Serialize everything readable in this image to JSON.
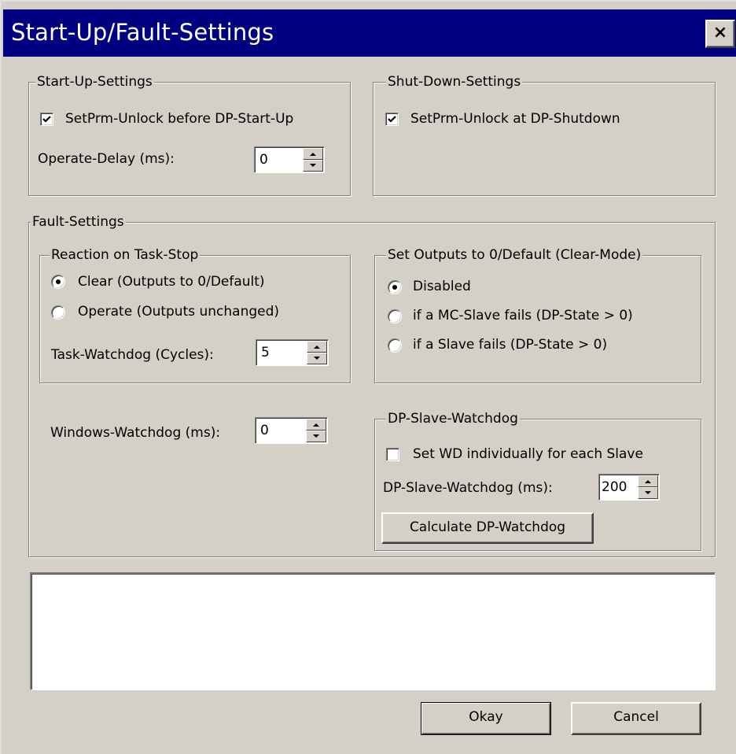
{
  "window": {
    "title": "Start-Up/Fault-Settings",
    "close_label": "×"
  },
  "startup": {
    "legend": "Start-Up-Settings",
    "setprm_unlock": {
      "label": "SetPrm-Unlock before DP-Start-Up",
      "checked": true
    },
    "operate_delay": {
      "label": "Operate-Delay (ms):",
      "value": "0"
    }
  },
  "shutdown": {
    "legend": "Shut-Down-Settings",
    "setprm_unlock": {
      "label": "SetPrm-Unlock at DP-Shutdown",
      "checked": true
    }
  },
  "fault": {
    "legend": "Fault-Settings",
    "reaction": {
      "legend": "Reaction on Task-Stop",
      "options": [
        {
          "label": "Clear (Outputs to 0/Default)",
          "selected": true
        },
        {
          "label": "Operate (Outputs unchanged)",
          "selected": false
        }
      ],
      "task_watchdog": {
        "label": "Task-Watchdog (Cycles):",
        "value": "5"
      }
    },
    "clear_mode": {
      "legend": "Set Outputs to 0/Default (Clear-Mode)",
      "options": [
        {
          "label": "Disabled",
          "selected": true
        },
        {
          "label": "if a MC-Slave fails (DP-State > 0)",
          "selected": false
        },
        {
          "label": "if a Slave fails (DP-State > 0)",
          "selected": false
        }
      ]
    },
    "windows_watchdog": {
      "label": "Windows-Watchdog (ms):",
      "value": "0"
    },
    "dp_slave_watchdog": {
      "legend": "DP-Slave-Watchdog",
      "set_individually": {
        "label": "Set WD individually for each Slave",
        "checked": false
      },
      "watchdog_ms": {
        "label": "DP-Slave-Watchdog (ms):",
        "value": "200"
      },
      "calculate_label": "Calculate DP-Watchdog"
    }
  },
  "message_box": {
    "text": ""
  },
  "buttons": {
    "okay": "Okay",
    "cancel": "Cancel"
  },
  "colors": {
    "titlebar": "#000080",
    "face": "#d4d0c8"
  }
}
